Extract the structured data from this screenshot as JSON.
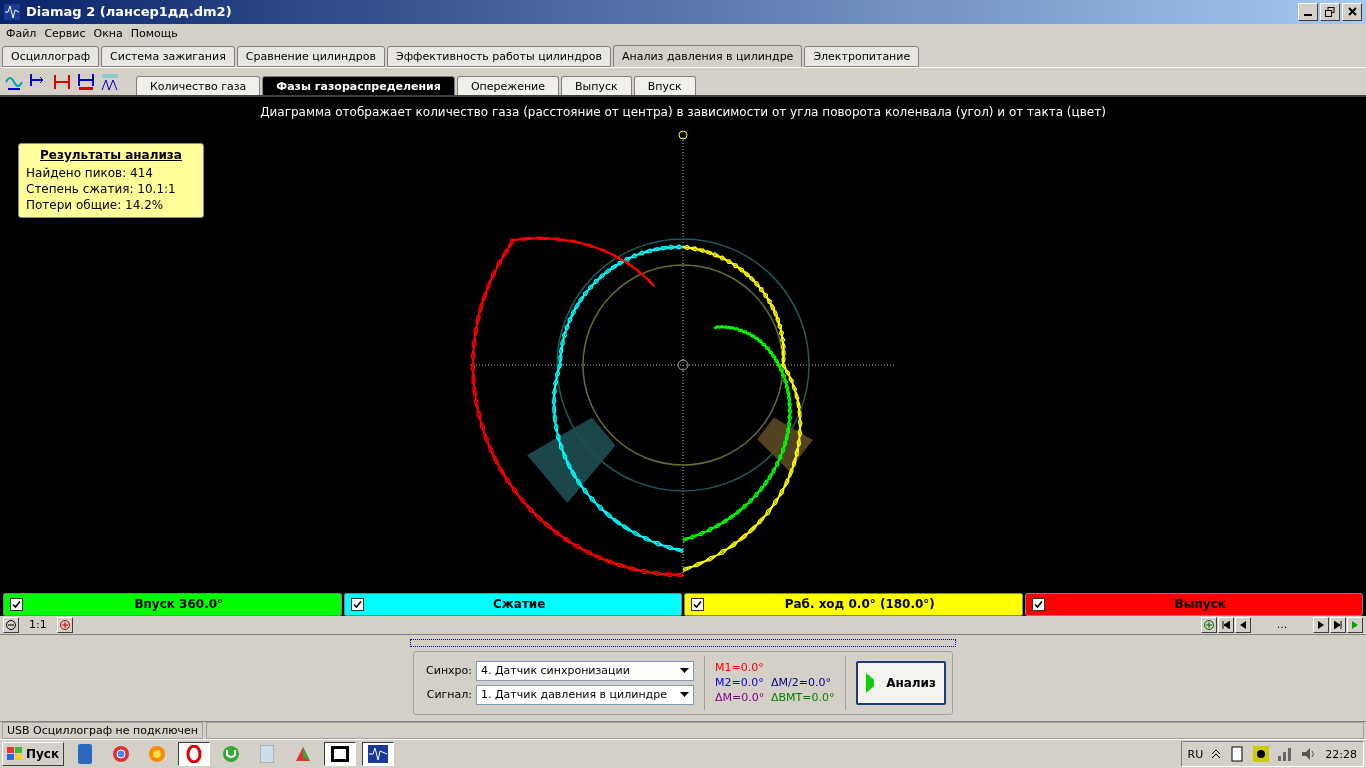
{
  "window": {
    "title": "Diamag 2 (лансер1дд.dm2)"
  },
  "menu": [
    "Файл",
    "Сервис",
    "Окна",
    "Помощь"
  ],
  "tabs": [
    {
      "label": "Осциллограф",
      "selected": false
    },
    {
      "label": "Система зажигания",
      "selected": false
    },
    {
      "label": "Сравнение цилиндров",
      "selected": false
    },
    {
      "label": "Эффективность работы цилиндров",
      "selected": false
    },
    {
      "label": "Анализ давления в цилиндре",
      "selected": true
    },
    {
      "label": "Электропитание",
      "selected": false
    }
  ],
  "sub_tabs": [
    {
      "label": "Количество газа",
      "selected": false
    },
    {
      "label": "Фазы газораспределения",
      "selected": true
    },
    {
      "label": "Опережение",
      "selected": false
    },
    {
      "label": "Выпуск",
      "selected": false
    },
    {
      "label": "Впуск",
      "selected": false
    }
  ],
  "diagram": {
    "caption": "Диаграмма отображает количество газа (расстояние от центра) в зависимости от угла поворота коленвала (угол) и от такта (цвет)",
    "results": {
      "title": "Результаты анализа",
      "lines": [
        "Найдено пиков: 414",
        "Степень сжатия: 10.1:1",
        "Потери общие: 14.2%"
      ]
    }
  },
  "legend": [
    {
      "label": "Впуск 360.0°",
      "checked": true,
      "color": "#00ff00"
    },
    {
      "label": "Сжатие",
      "checked": true,
      "color": "#00ffff"
    },
    {
      "label": "Раб. ход 0.0° (180.0°)",
      "checked": true,
      "color": "#ffff00"
    },
    {
      "label": "Выпуск",
      "checked": true,
      "color": "#ff0000"
    }
  ],
  "zoom_bar": {
    "scale": "1:1",
    "position": "..."
  },
  "controls": {
    "fields": [
      {
        "label": "Синхро:",
        "value": "4.  Датчик синхронизации"
      },
      {
        "label": "Сигнал:",
        "value": "1.  Датчик давления в цилиндре"
      }
    ],
    "markers": [
      {
        "text": "M1=0.0°",
        "color": "#ff0000"
      },
      {
        "text": "M2=0.0°",
        "color": "#0000ff"
      },
      {
        "text": "ΔM/2=0.0°",
        "color": "#000080"
      },
      {
        "text": "ΔM=0.0°",
        "color": "#800080"
      },
      {
        "text": "ΔBMT=0.0°",
        "color": "#008000"
      }
    ],
    "analyze_button": "Анализ"
  },
  "status_bar": [
    "USB Осциллограф не подключен"
  ],
  "taskbar": {
    "start": "Пуск",
    "language": "RU",
    "clock": "22:28"
  }
}
